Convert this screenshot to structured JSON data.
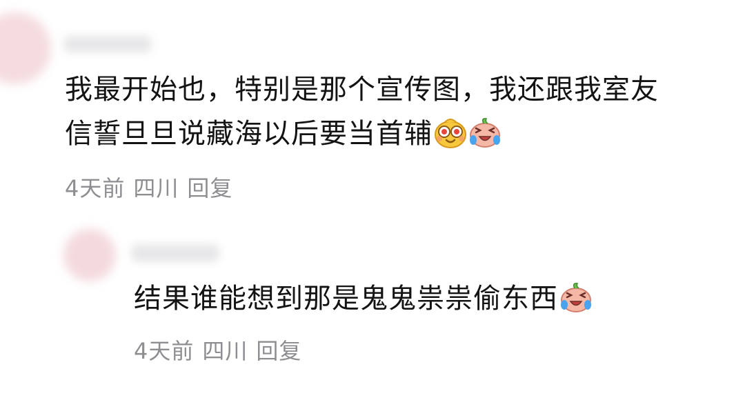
{
  "comments": [
    {
      "text_lines": [
        "我最开始也，特别是那个宣传图，我还跟我室友",
        "信誓旦旦说藏海以后要当首辅"
      ],
      "emojis": [
        "glowing-eyes-emoji-icon",
        "laugh-cry-emoji-icon"
      ],
      "time": "4天前",
      "location": "四川",
      "reply_label": "回复"
    },
    {
      "text_lines": [
        "结果谁能想到那是鬼鬼祟祟偷东西"
      ],
      "emojis": [
        "laugh-cry-emoji-icon"
      ],
      "time": "4天前",
      "location": "四川",
      "reply_label": "回复"
    }
  ],
  "watermark": "",
  "colors": {
    "text": "#131313",
    "meta": "#8e8e92",
    "avatar_pink": "#f1d3d6"
  }
}
